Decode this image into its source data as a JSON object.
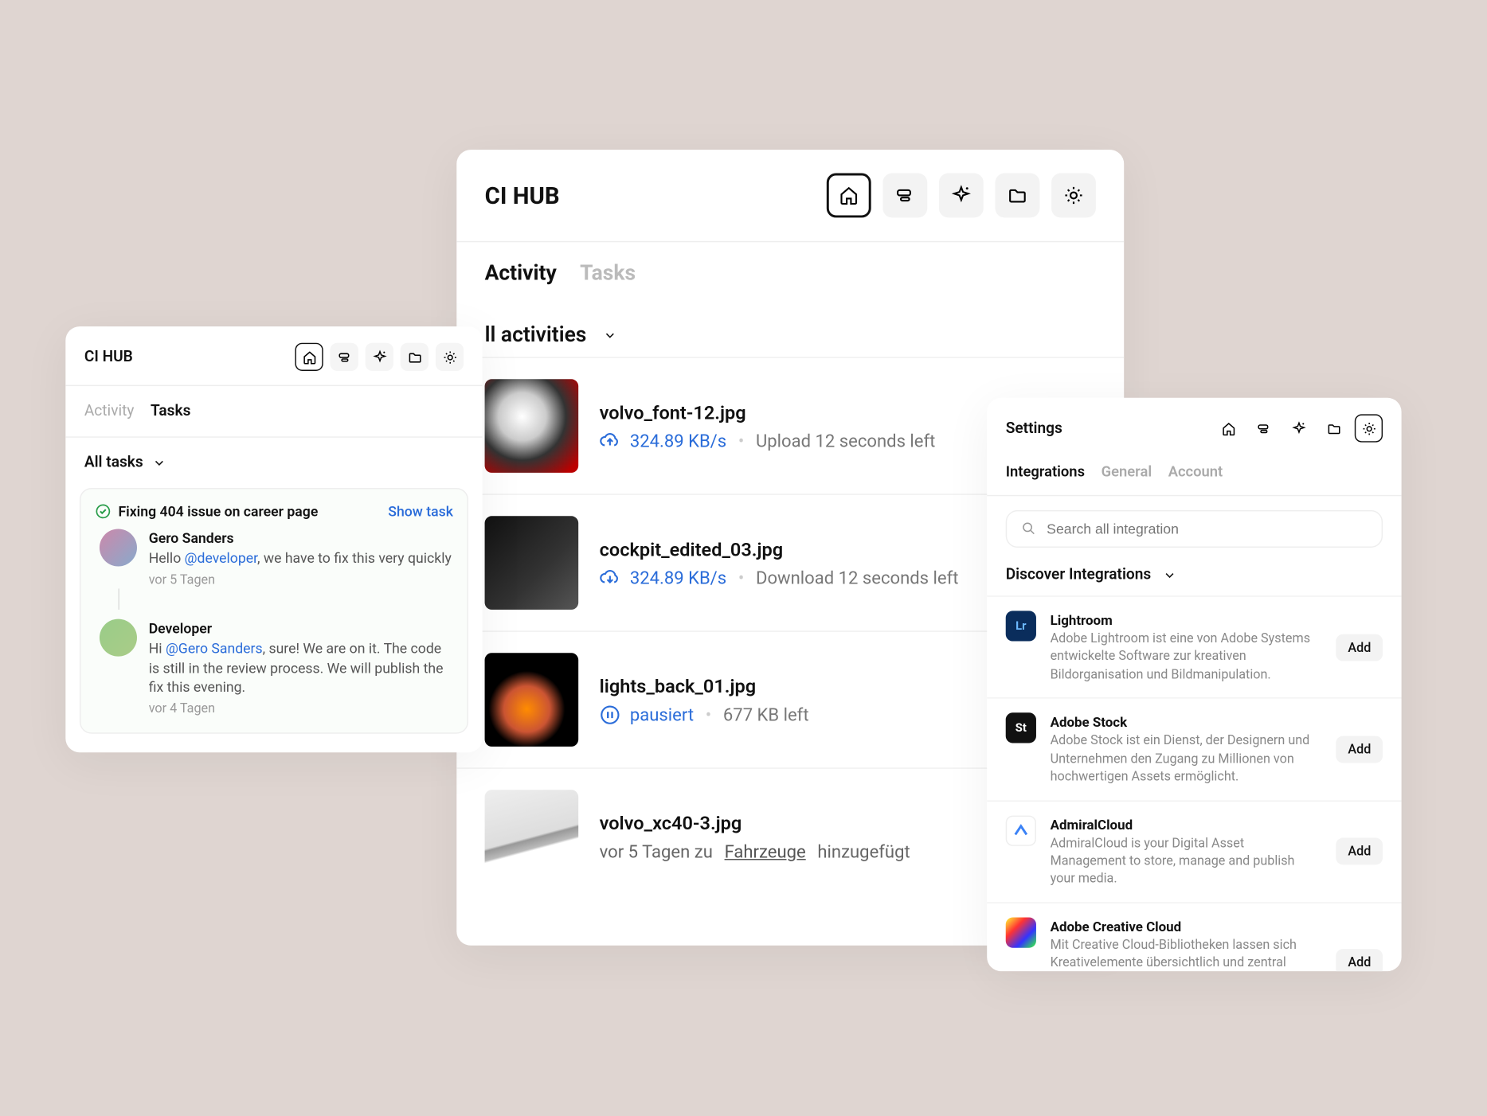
{
  "app_name": "CI HUB",
  "left": {
    "title": "CI HUB",
    "tabs": {
      "activity": "Activity",
      "tasks": "Tasks"
    },
    "filter": "All tasks",
    "task": {
      "title": "Fixing 404 issue on career page",
      "show": "Show task",
      "comments": [
        {
          "author": "Gero Sanders",
          "prefix": "Hello ",
          "mention": "@developer",
          "text": ", we have to fix this very quickly",
          "time": "vor 5 Tagen"
        },
        {
          "author": "Developer",
          "prefix": "Hi ",
          "mention": "@Gero Sanders",
          "text": ", sure! We are on it. The code is still in the review process. We will publish the fix this evening.",
          "time": "vor 4 Tagen"
        }
      ]
    }
  },
  "mid": {
    "title": "CI HUB",
    "tabs": {
      "activity": "Activity",
      "tasks": "Tasks"
    },
    "filter": "ll activities",
    "files": [
      {
        "name": "volvo_font-12.jpg",
        "speed": "324.89 KB/s",
        "status": "Upload 12 seconds left",
        "mode": "upload"
      },
      {
        "name": "cockpit_edited_03.jpg",
        "speed": "324.89 KB/s",
        "status": "Download 12 seconds left",
        "mode": "download"
      },
      {
        "name": "lights_back_01.jpg",
        "paused": "pausiert",
        "status": "677 KB left",
        "mode": "paused"
      },
      {
        "name": "volvo_xc40-3.jpg",
        "added_prefix": "vor 5 Tagen zu ",
        "added_link": "Fahrzeuge",
        "added_suffix": " hinzugefügt",
        "mode": "added"
      }
    ]
  },
  "right": {
    "title": "Settings",
    "tabs": {
      "integrations": "Integrations",
      "general": "General",
      "account": "Account"
    },
    "search_placeholder": "Search all integration",
    "discover": "Discover Integrations",
    "add_label": "Add",
    "integrations": [
      {
        "name": "Lightroom",
        "desc": "Adobe Lightroom ist eine von Adobe Systems entwickelte Software zur kreativen Bildorganisation und Bildmanipulation."
      },
      {
        "name": "Adobe Stock",
        "desc": "Adobe Stock ist ein Dienst, der Designern und Unternehmen den Zugang zu Millionen von hochwertigen Assets ermöglicht."
      },
      {
        "name": "AdmiralCloud",
        "desc": "AdmiralCloud is your Digital Asset Management to store, manage and publish your media."
      },
      {
        "name": "Adobe Creative Cloud",
        "desc": "Mit Creative Cloud-Bibliotheken lassen sich Kreativelemente übersichtlich und zentral verwalten und organisieren. So erhalten Designs, Websites,"
      }
    ]
  }
}
